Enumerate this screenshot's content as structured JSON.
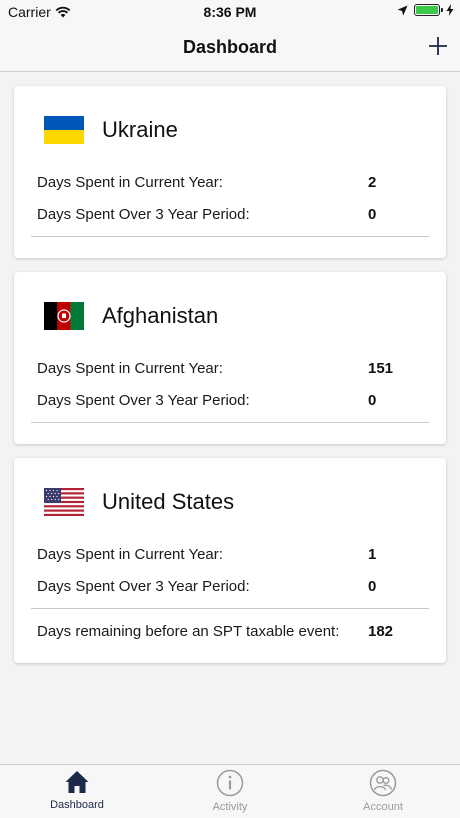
{
  "status_bar": {
    "carrier": "Carrier",
    "time": "8:36 PM",
    "battery_color": "#3cc84a"
  },
  "nav": {
    "title": "Dashboard",
    "add_icon": "plus-icon"
  },
  "cards": [
    {
      "country": "Ukraine",
      "flag_icon": "ukraine-flag-icon",
      "rows": [
        {
          "label": "Days Spent in Current Year:",
          "value": "2"
        },
        {
          "label": "Days Spent Over 3 Year Period:",
          "value": "0"
        }
      ]
    },
    {
      "country": "Afghanistan",
      "flag_icon": "afghanistan-flag-icon",
      "rows": [
        {
          "label": "Days Spent in Current Year:",
          "value": "151"
        },
        {
          "label": "Days Spent Over 3 Year Period:",
          "value": "0"
        }
      ]
    },
    {
      "country": "United States",
      "flag_icon": "usa-flag-icon",
      "rows": [
        {
          "label": "Days Spent in Current Year:",
          "value": "1"
        },
        {
          "label": "Days Spent Over 3 Year Period:",
          "value": "0"
        },
        {
          "label": "Days remaining before an SPT taxable event:",
          "value": "182"
        }
      ]
    }
  ],
  "tabs": [
    {
      "label": "Dashboard",
      "icon": "home-icon",
      "active": true
    },
    {
      "label": "Activity",
      "icon": "info-icon",
      "active": false
    },
    {
      "label": "Account",
      "icon": "account-icon",
      "active": false
    }
  ],
  "colors": {
    "active_tab": "#1b2a4a",
    "inactive_tab": "#9a9a9a",
    "ukraine_blue": "#0057b7",
    "ukraine_yellow": "#ffd700"
  }
}
